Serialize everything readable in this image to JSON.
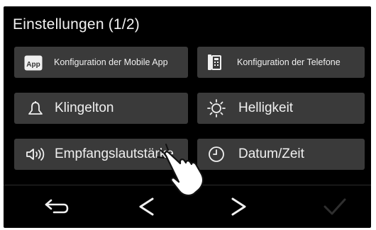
{
  "screen": {
    "title": "Einstellungen (1/2)",
    "buttons": [
      {
        "label": "Konfiguration der Mobile App",
        "icon": "mobile-app-icon",
        "badge": "App"
      },
      {
        "label": "Konfiguration der Telefone",
        "icon": "telephone-icon"
      },
      {
        "label": "Klingelton",
        "icon": "bell-icon"
      },
      {
        "label": "Helligkeit",
        "icon": "sun-icon"
      },
      {
        "label": "Empfangslautstärke",
        "icon": "speaker-volume-icon"
      },
      {
        "label": "Datum/Zeit",
        "icon": "clock-icon"
      }
    ],
    "nav": {
      "back": "back-arrow-icon",
      "prev": "chevron-left-icon",
      "next": "chevron-right-icon",
      "confirm": "checkmark-icon"
    },
    "colors": {
      "background": "#000000",
      "button": "#3a3a3a",
      "text": "#f0f0f0",
      "confirm_disabled": "#2f2f2f"
    }
  }
}
